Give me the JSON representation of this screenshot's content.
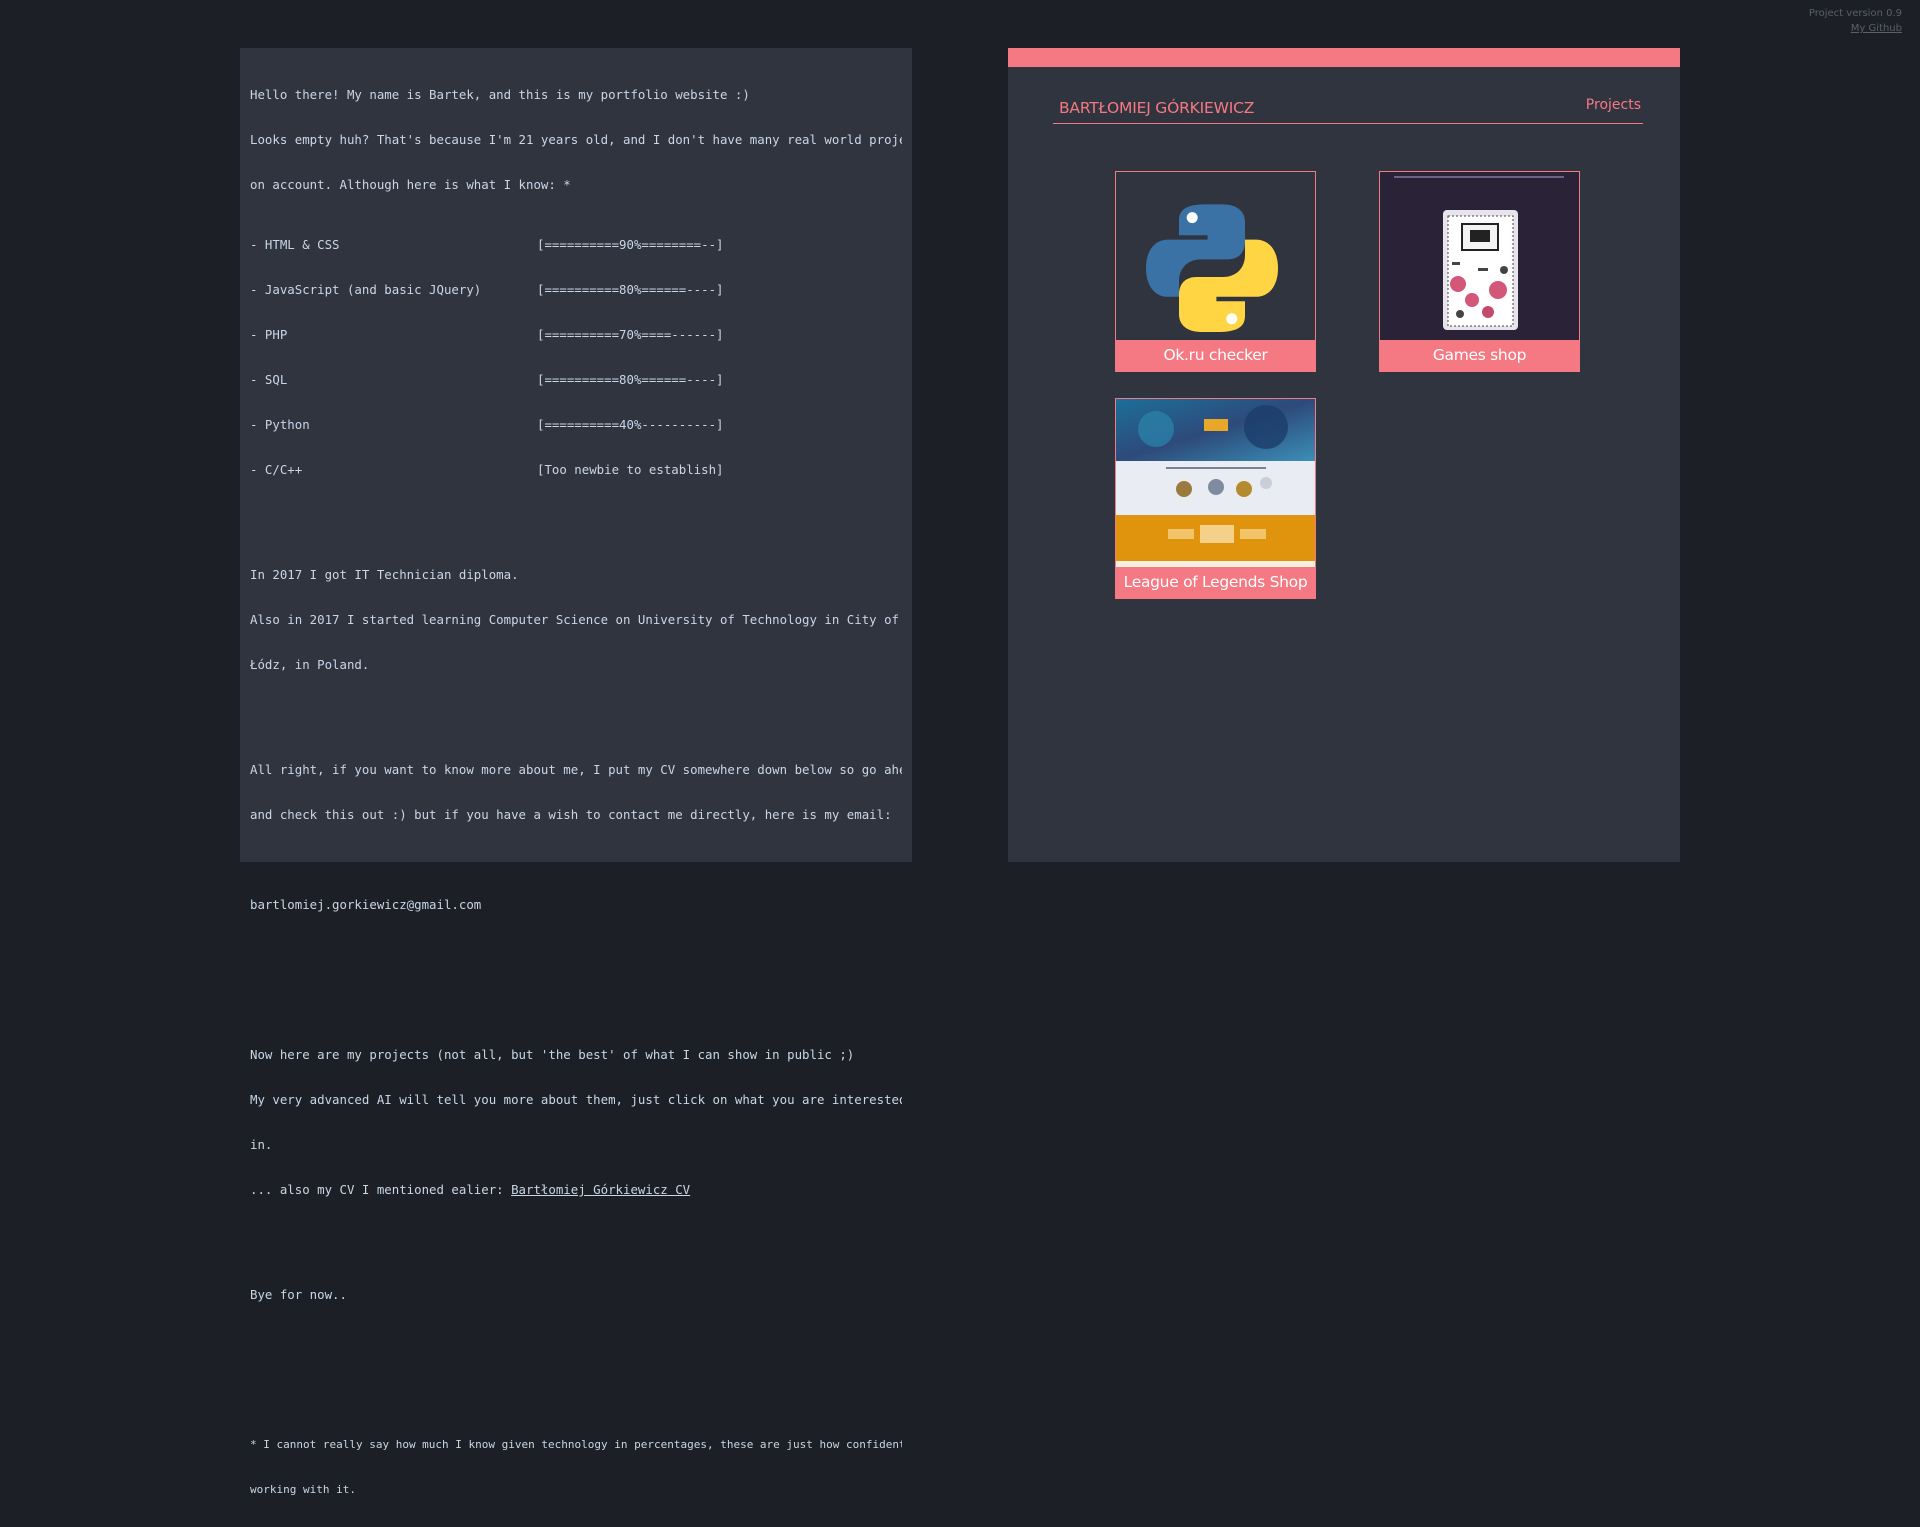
{
  "corner": {
    "version": "Project version 0.9",
    "github": "My Github"
  },
  "terminal": {
    "intro": [
      "Hello there! My name is Bartek, and this is my portfolio website :)",
      "Looks empty huh? That's because I'm 21 years old, and I don't have many real world projects",
      "on account. Although here is what I know: *"
    ],
    "skills": [
      {
        "name": "- HTML & CSS",
        "bar": "[==========90%========--]"
      },
      {
        "name": "- JavaScript (and basic JQuery)",
        "bar": "[==========80%======----]"
      },
      {
        "name": "- PHP",
        "bar": "[==========70%====------]"
      },
      {
        "name": "- SQL",
        "bar": "[==========80%======----]"
      },
      {
        "name": "- Python",
        "bar": "[==========40%----------]"
      },
      {
        "name": "- C/C++",
        "bar": "[Too newbie to establish]"
      }
    ],
    "education": [
      "In 2017 I got IT Technician diploma.",
      "Also in 2017 I started learning Computer Science on University of Technology in City of",
      "Łódz, in Poland."
    ],
    "contact": [
      "All right, if you want to know more about me, I put my CV somewhere down below so go ahead",
      "and check this out :) but if you have a wish to contact me directly, here is my email:"
    ],
    "email": "bartlomiej.gorkiewicz@gmail.com",
    "projects_intro": [
      "Now here are my projects (not all, but 'the best' of what I can show in public ;)",
      "My very advanced AI will tell you more about them, just click on what you are interested",
      "in."
    ],
    "cv_prefix": "... also my CV I mentioned ealier: ",
    "cv_link": "Bartłomiej Górkiewicz CV",
    "bye": "Bye for now..",
    "footnote": [
      "* I cannot really say how much I know given technology in percentages, these are just how confident I am when",
      "working with it."
    ]
  },
  "portfolio": {
    "name": "BARTŁOMIEJ GÓRKIEWICZ",
    "nav_projects": "Projects",
    "projects": [
      {
        "label": "Ok.ru checker",
        "icon": "python-logo"
      },
      {
        "label": "Games shop",
        "icon": "gameboy-screenshot"
      },
      {
        "label": "League of Legends Shop",
        "icon": "lol-shop-screenshot"
      }
    ]
  },
  "colors": {
    "background": "#1c1f26",
    "panel": "#30343f",
    "accent": "#f47983",
    "terminal_text": "#c9d6e6"
  }
}
